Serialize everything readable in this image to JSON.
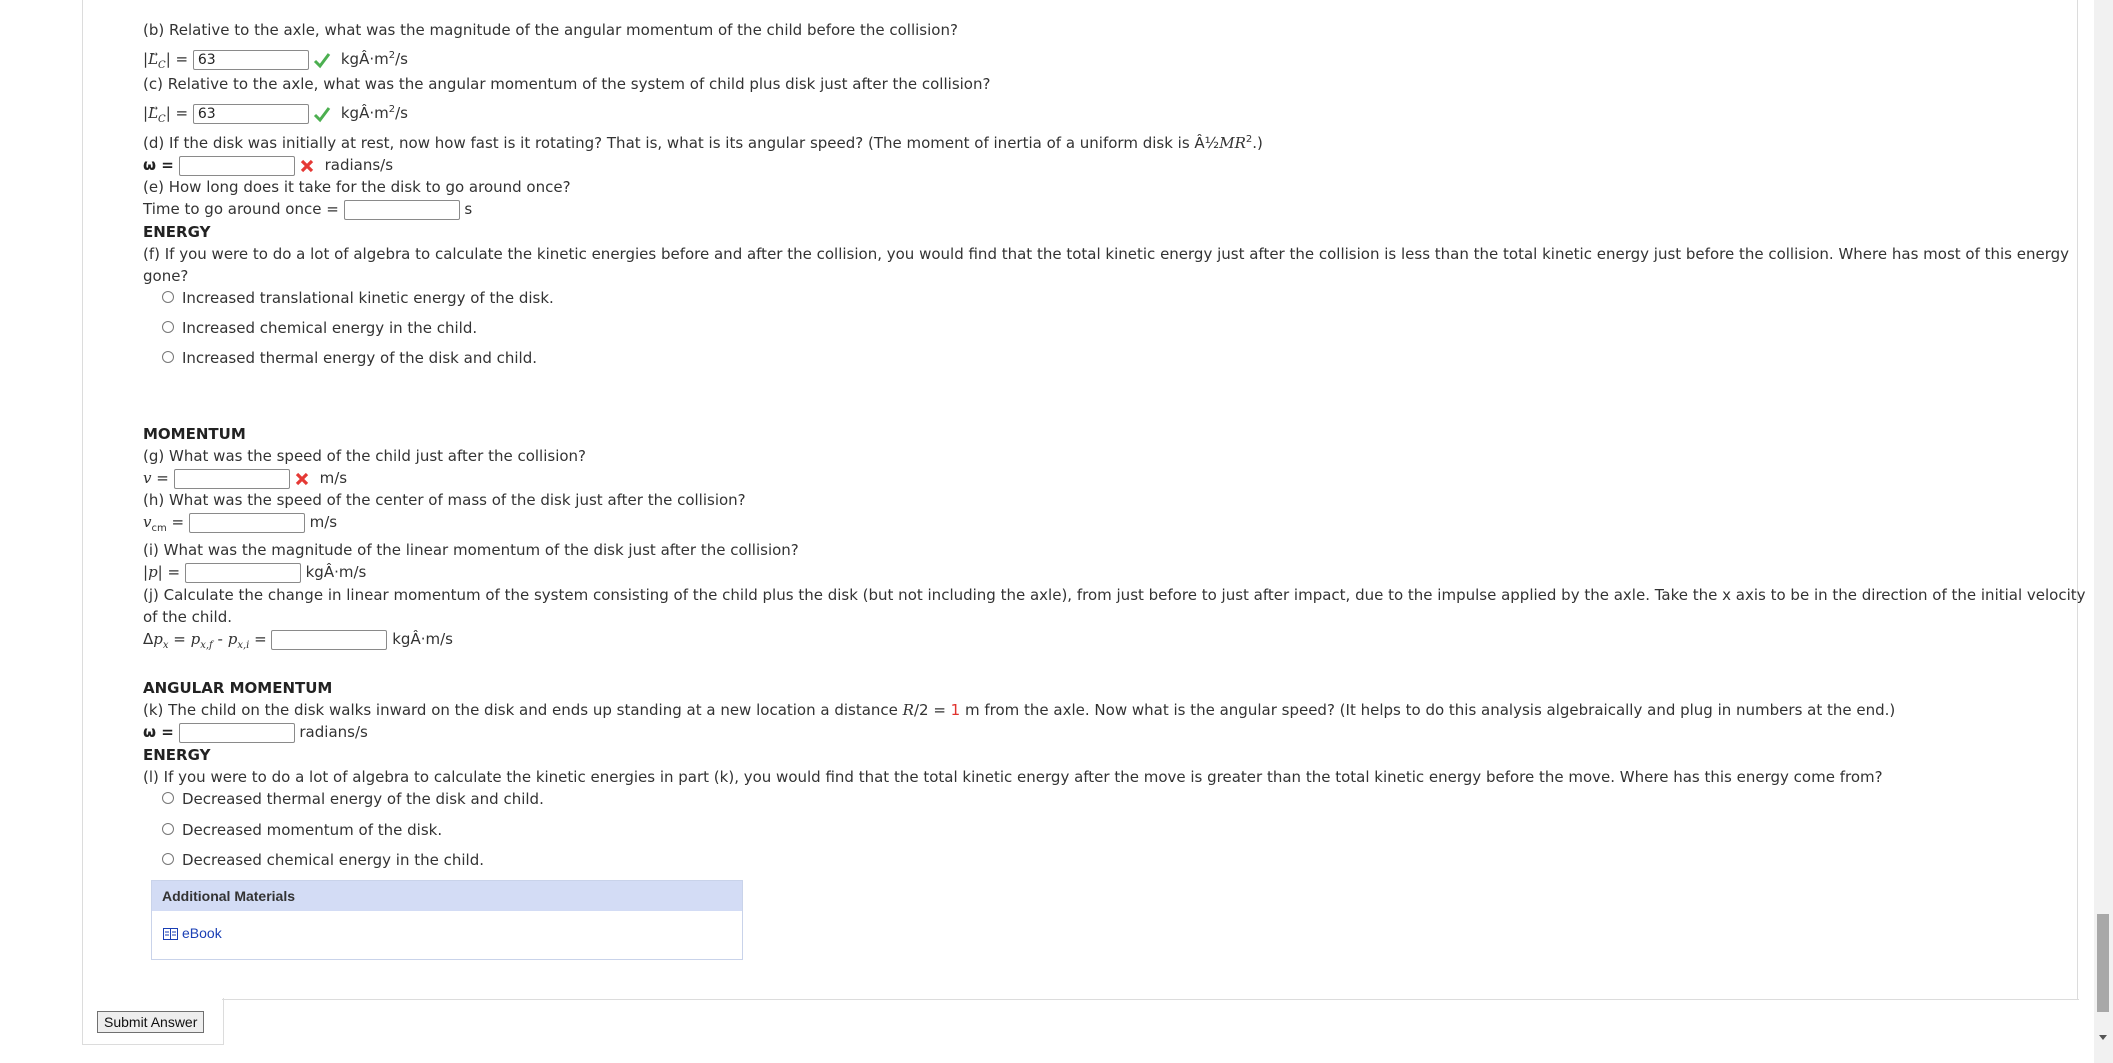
{
  "b": {
    "question": "(b) Relative to the axle, what was the magnitude of the angular momentum of the child before the collision?",
    "sym": "L",
    "sub": "C",
    "value": "63",
    "unit_pre": "kgÂ·m",
    "unit_exp": "2",
    "unit_post": "/s"
  },
  "c": {
    "question": "(c) Relative to the axle, what was the angular momentum of the system of child plus disk just after the collision?",
    "sym": "L",
    "sub": "C",
    "value": "63",
    "unit_pre": "kgÂ·m",
    "unit_exp": "2",
    "unit_post": "/s"
  },
  "d": {
    "question_pre": "(d) If the disk was initially at rest, now how fast is it rotating? That is, what is its angular speed? (The moment of inertia of a uniform disk is Â½",
    "question_var": "MR",
    "question_exp": "2",
    "question_post": ".)",
    "label": "ω =",
    "unit": "radians/s"
  },
  "e": {
    "question": "(e) How long does it take for the disk to go around once?",
    "label": "Time to go around once =",
    "unit": "s"
  },
  "energy1": {
    "heading": "ENERGY",
    "q_line1": "(f) If you were to do a lot of algebra to calculate the kinetic energies before and after the collision, you would find that the total kinetic energy just after the collision is less than the total kinetic energy just before the collision. Where has most of this energy",
    "q_line2": "gone?",
    "options": [
      "Increased translational kinetic energy of the disk.",
      "Increased chemical energy in the child.",
      "Increased thermal energy of the disk and child."
    ]
  },
  "momentum": {
    "heading": "MOMENTUM",
    "g_q": "(g) What was the speed of the child just after the collision?",
    "g_label": "v",
    "g_unit": "m/s",
    "h_q": "(h) What was the speed of the center of mass of the disk just after the collision?",
    "h_label": "v",
    "h_sub": "cm",
    "h_unit": "m/s",
    "i_q": "(i) What was the magnitude of the linear momentum of the disk just after the collision?",
    "i_label": "p",
    "i_unit": "kgÂ·m/s",
    "j_line1": "(j) Calculate the change in linear momentum of the system consisting of the child plus the disk (but not including the axle), from just before to just after impact, due to the impulse applied by the axle. Take the x axis to be in the direction of the initial velocity",
    "j_line2": "of the child.",
    "j_unit": "kgÂ·m/s"
  },
  "angular": {
    "heading": "ANGULAR MOMENTUM",
    "k_pre": "(k) The child on the disk walks inward on the disk and ends up standing at a new location a distance ",
    "k_var": "R",
    "k_mid": "/2 = ",
    "k_num": "1",
    "k_post": " m from the axle. Now what is the angular speed? (It helps to do this analysis algebraically and plug in numbers at the end.)",
    "label": "ω =",
    "unit": "radians/s"
  },
  "energy2": {
    "heading": "ENERGY",
    "question": "(l) If you were to do a lot of algebra to calculate the kinetic energies in part (k), you would find that the total kinetic energy after the move is greater than the total kinetic energy before the move. Where has this energy come from?",
    "options": [
      "Decreased thermal energy of the disk and child.",
      "Decreased momentum of the disk.",
      "Decreased chemical energy in the child."
    ]
  },
  "additional": {
    "title": "Additional Materials",
    "link": "eBook"
  },
  "submit_label": "Submit Answer",
  "colors": {
    "check": "#4caf50",
    "x": "#e53935",
    "panel": "#d3dcf5",
    "link": "#1a3fb5"
  }
}
